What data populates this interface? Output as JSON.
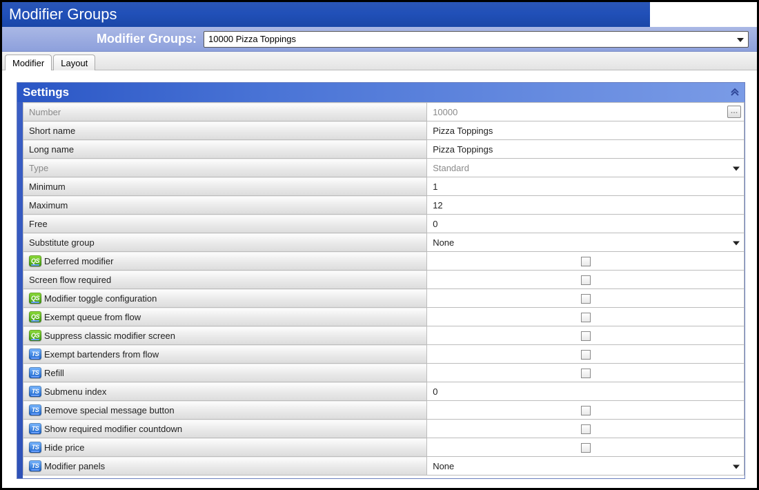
{
  "window": {
    "title": "Modifier Groups"
  },
  "selector": {
    "label": "Modifier Groups:",
    "value": "10000 Pizza Toppings"
  },
  "tabs": [
    {
      "label": "Modifier",
      "active": true
    },
    {
      "label": "Layout",
      "active": false
    }
  ],
  "settings": {
    "header": "Settings",
    "rows": [
      {
        "icon": null,
        "label": "Number",
        "kind": "text-ellipsis",
        "value": "10000",
        "dim": true
      },
      {
        "icon": null,
        "label": "Short name",
        "kind": "text",
        "value": "Pizza Toppings",
        "dim": false
      },
      {
        "icon": null,
        "label": "Long name",
        "kind": "text",
        "value": "Pizza Toppings",
        "dim": false
      },
      {
        "icon": null,
        "label": "Type",
        "kind": "dropdown",
        "value": "Standard",
        "dim": true
      },
      {
        "icon": null,
        "label": "Minimum",
        "kind": "text",
        "value": "1",
        "dim": false
      },
      {
        "icon": null,
        "label": "Maximum",
        "kind": "text",
        "value": "12",
        "dim": false
      },
      {
        "icon": null,
        "label": "Free",
        "kind": "text",
        "value": "0",
        "dim": false
      },
      {
        "icon": null,
        "label": "Substitute group",
        "kind": "dropdown",
        "value": "None",
        "dim": false
      },
      {
        "icon": "qs",
        "label": "Deferred modifier",
        "kind": "checkbox",
        "value": "",
        "dim": false
      },
      {
        "icon": null,
        "label": "Screen flow required",
        "kind": "checkbox",
        "value": "",
        "dim": false
      },
      {
        "icon": "qs",
        "label": "Modifier toggle configuration",
        "kind": "checkbox",
        "value": "",
        "dim": false
      },
      {
        "icon": "qs",
        "label": "Exempt queue from flow",
        "kind": "checkbox",
        "value": "",
        "dim": false
      },
      {
        "icon": "qs",
        "label": "Suppress classic modifier screen",
        "kind": "checkbox",
        "value": "",
        "dim": false
      },
      {
        "icon": "ts",
        "label": "Exempt bartenders from flow",
        "kind": "checkbox",
        "value": "",
        "dim": false
      },
      {
        "icon": "ts",
        "label": "Refill",
        "kind": "checkbox",
        "value": "",
        "dim": false
      },
      {
        "icon": "ts",
        "label": "Submenu index",
        "kind": "text",
        "value": "0",
        "dim": false
      },
      {
        "icon": "ts",
        "label": "Remove special message button",
        "kind": "checkbox",
        "value": "",
        "dim": false
      },
      {
        "icon": "ts",
        "label": "Show required modifier countdown",
        "kind": "checkbox",
        "value": "",
        "dim": false
      },
      {
        "icon": "ts",
        "label": "Hide price",
        "kind": "checkbox",
        "value": "",
        "dim": false
      },
      {
        "icon": "ts",
        "label": "Modifier panels",
        "kind": "dropdown",
        "value": "None",
        "dim": false
      }
    ]
  }
}
